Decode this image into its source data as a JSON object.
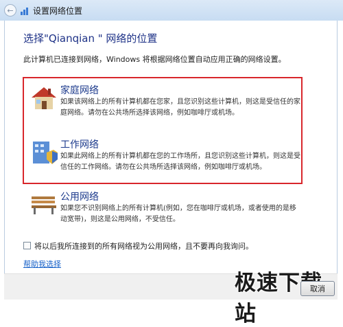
{
  "window": {
    "title": "设置网络位置"
  },
  "heading": "选择\"Qianqian \" 网络的位置",
  "intro": "此计算机已连接到网络，Windows 将根据网络位置自动应用正确的网络设置。",
  "options": [
    {
      "icon": "house-icon",
      "title": "家庭网络",
      "desc": "如果该网络上的所有计算机都在您家，且您识别这些计算机，则这是受信任的家庭网络。请勿在公共场所选择该网络，例如咖啡厅或机场。"
    },
    {
      "icon": "office-building-icon",
      "title": "工作网络",
      "desc": "如果此网络上的所有计算机都在您的工作场所，且您识别这些计算机，则这是受信任的工作网络。请勿在公共场所选择该网络，例如咖啡厅或机场。"
    },
    {
      "icon": "park-bench-icon",
      "title": "公用网络",
      "desc": "如果您不识别网络上的所有计算机(例如，您在咖啡厅或机场，或者使用的是移动宽带)，则这是公用网络，不受信任。"
    }
  ],
  "checkbox": {
    "label": "将以后我所连接到的所有网络视为公用网络，且不要再向我询问。",
    "checked": false
  },
  "help_link": "帮助我选择",
  "footer": {
    "cancel_label": "取消",
    "watermark": "极速下载站"
  }
}
